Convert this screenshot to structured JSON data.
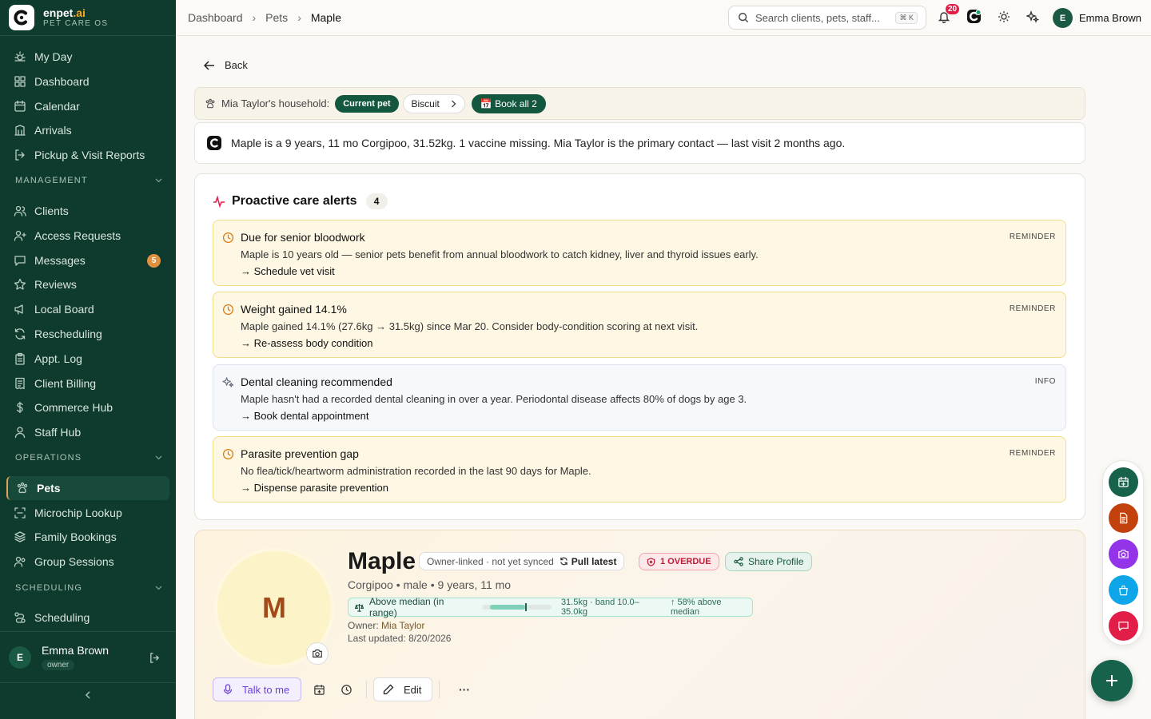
{
  "brand": {
    "name": "enpet",
    "name_suffix": ".ai",
    "subtitle": "PET CARE OS"
  },
  "sidebar": {
    "main_items": [
      {
        "label": "My Day",
        "icon": "sun-icon"
      },
      {
        "label": "Dashboard",
        "icon": "grid-icon"
      },
      {
        "label": "Calendar",
        "icon": "calendar-icon"
      },
      {
        "label": "Arrivals",
        "icon": "building-icon"
      },
      {
        "label": "Pickup & Visit Reports",
        "icon": "logout-icon"
      }
    ],
    "management_label": "MANAGEMENT",
    "management_items": [
      {
        "label": "Clients",
        "icon": "users-icon"
      },
      {
        "label": "Access Requests",
        "icon": "user-plus-icon"
      },
      {
        "label": "Messages",
        "icon": "message-icon",
        "badge": "5"
      },
      {
        "label": "Reviews",
        "icon": "star-icon"
      },
      {
        "label": "Local Board",
        "icon": "megaphone-icon"
      },
      {
        "label": "Rescheduling",
        "icon": "refresh-icon"
      },
      {
        "label": "Appt. Log",
        "icon": "clipboard-icon"
      },
      {
        "label": "Client Billing",
        "icon": "receipt-icon"
      },
      {
        "label": "Commerce Hub",
        "icon": "dollar-icon"
      },
      {
        "label": "Staff Hub",
        "icon": "staff-icon"
      }
    ],
    "operations_label": "OPERATIONS",
    "operations_items": [
      {
        "label": "Pets",
        "icon": "paw-icon",
        "active": true
      },
      {
        "label": "Microchip Lookup",
        "icon": "scan-icon"
      },
      {
        "label": "Family Bookings",
        "icon": "layers-icon"
      },
      {
        "label": "Group Sessions",
        "icon": "group-icon"
      }
    ],
    "scheduling_label": "SCHEDULING",
    "scheduling_items": [
      {
        "label": "Scheduling",
        "icon": "route-icon"
      }
    ],
    "user": {
      "initial": "E",
      "name": "Emma Brown",
      "role": "owner"
    }
  },
  "topbar": {
    "breadcrumbs": [
      "Dashboard",
      "Pets",
      "Maple"
    ],
    "search_placeholder": "Search clients, pets, staff...",
    "search_shortcut": "⌘ K",
    "notification_count": "20",
    "user_initial": "E",
    "user_name": "Emma Brown"
  },
  "main": {
    "back_label": "Back",
    "household": {
      "label": "Mia Taylor's household:",
      "current_pet_label": "Current pet",
      "other_pet": "Biscuit",
      "book_all_label": "📅 Book all 2"
    },
    "summary": "Maple is a 9 years, 11 mo Corgipoo, 31.52kg. 1 vaccine missing. Mia Taylor is the primary contact — last visit 2 months ago.",
    "alerts_title": "Proactive care alerts",
    "alerts_count": "4",
    "alerts": [
      {
        "title": "Due for senior bloodwork",
        "description": "Maple is 10 years old — senior pets benefit from annual bloodwork to catch kidney, liver and thyroid issues early.",
        "action": "→ Schedule vet visit",
        "tag": "REMINDER",
        "kind": "reminder",
        "icon": "clock-icon"
      },
      {
        "title": "Weight gained 14.1%",
        "description": "Maple gained 14.1% (27.6kg → 31.5kg) since Mar 20. Consider body-condition scoring at next visit.",
        "action": "→ Re-assess body condition",
        "tag": "REMINDER",
        "kind": "reminder",
        "icon": "clock-icon"
      },
      {
        "title": "Dental cleaning recommended",
        "description": "Maple hasn't had a recorded dental cleaning in over a year. Periodontal disease affects 80% of dogs by age 3.",
        "action": "→ Book dental appointment",
        "tag": "INFO",
        "kind": "info",
        "icon": "sparkles-icon"
      },
      {
        "title": "Parasite prevention gap",
        "description": "No flea/tick/heartworm administration recorded in the last 90 days for Maple.",
        "action": "→ Dispense parasite prevention",
        "tag": "REMINDER",
        "kind": "reminder",
        "icon": "clock-icon"
      }
    ],
    "profile": {
      "avatar_initial": "M",
      "name": "Maple",
      "sync_status": "Owner-linked · not yet synced",
      "pull_label": "Pull latest",
      "overdue_label": "1 OVERDUE",
      "share_label": "Share Profile",
      "meta": "Corgipoo • male • 9 years, 11 mo",
      "weight_status": "Above median (in range)",
      "weight_detail": "31.5kg · band 10.0–35.0kg",
      "weight_trend": "↑ 58% above median",
      "weight_band_position": 0.61,
      "owner_label": "Owner:",
      "owner_value": "Mia Taylor",
      "updated_label": "Last updated:",
      "updated_value": "8/20/2026",
      "talk_label": "Talk to me",
      "edit_label": "Edit",
      "more_label": "···"
    }
  },
  "fab": {
    "colors": [
      "#17624a",
      "#c2410c",
      "#9333ea",
      "#0ea5e9",
      "#e11d48"
    ],
    "icons": [
      "calendar-plus-icon",
      "document-icon",
      "camera-icon",
      "bag-icon",
      "chat-icon"
    ]
  }
}
